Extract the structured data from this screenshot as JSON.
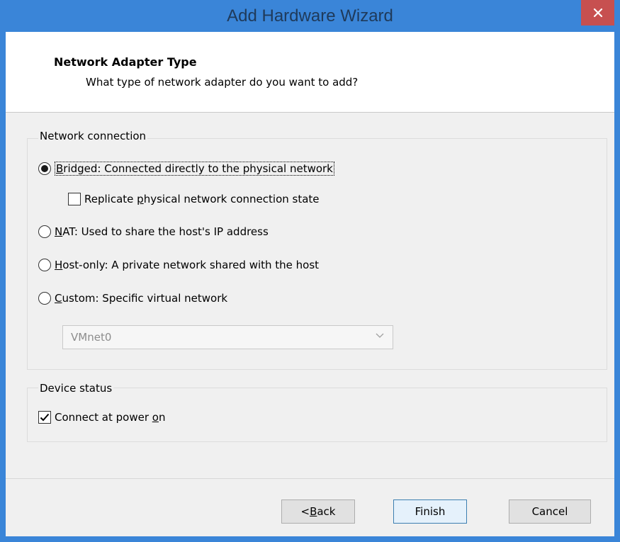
{
  "window": {
    "title": "Add Hardware Wizard"
  },
  "header": {
    "title": "Network Adapter Type",
    "subtitle": "What type of network adapter do you want to add?"
  },
  "network_connection": {
    "label": "Network connection",
    "options": [
      {
        "pre": "",
        "key": "B",
        "rest": "ridged: Connected directly to the physical network",
        "selected": true
      },
      {
        "pre": "",
        "key": "N",
        "rest": "AT: Used to share the host's IP address",
        "selected": false
      },
      {
        "pre": "",
        "key": "H",
        "rest": "ost-only: A private network shared with the host",
        "selected": false
      },
      {
        "pre": "",
        "key": "C",
        "rest": "ustom: Specific virtual network",
        "selected": false
      }
    ],
    "replicate": {
      "pre": "Replicate ",
      "key": "p",
      "rest": "hysical network connection state",
      "checked": false
    },
    "vmnet_select": {
      "value": "VMnet0",
      "enabled": false
    }
  },
  "device_status": {
    "label": "Device status",
    "connect_at_power_on": {
      "pre": "Connect at power ",
      "key": "o",
      "rest": "n",
      "checked": true
    }
  },
  "buttons": {
    "back": {
      "pre": "< ",
      "key": "B",
      "rest": "ack"
    },
    "finish": "Finish",
    "cancel": "Cancel"
  },
  "colors": {
    "titlebar": "#3a85d8",
    "close_button": "#c75050",
    "dialog_body": "#f0f0f0"
  },
  "icons": {
    "close": "close-icon",
    "chevron": "chevron-down-icon",
    "check": "checkmark-icon"
  }
}
